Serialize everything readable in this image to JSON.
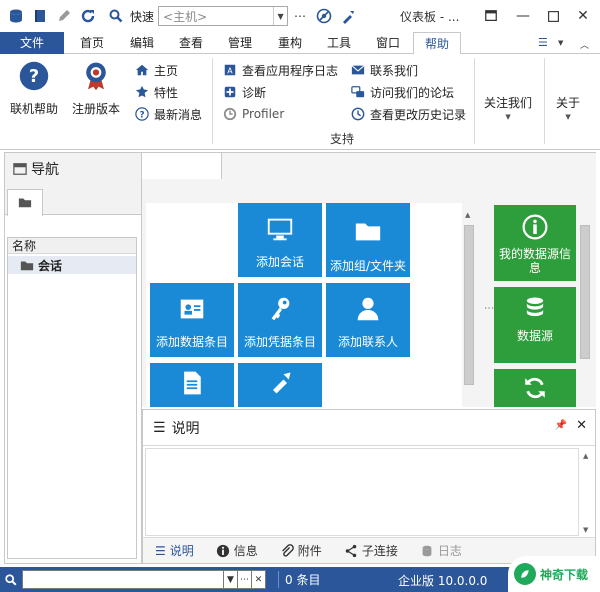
{
  "titlebar": {
    "quick_label": "快速",
    "host_placeholder": "<主机>",
    "window_title": "仪表板 - ...",
    "icons": [
      "database-icon",
      "book-icon",
      "pencil-icon",
      "refresh-icon",
      "search-icon",
      "more-icon",
      "disconnect-icon",
      "tool-icon",
      "pin-window-icon",
      "minimize-icon",
      "restore-icon",
      "close-icon"
    ]
  },
  "ribbon_tabs": [
    "文件",
    "首页",
    "编辑",
    "查看",
    "管理",
    "重构",
    "工具",
    "窗口",
    "帮助"
  ],
  "ribbon": {
    "online_help": "联机帮助",
    "register": "注册版本",
    "home": "主页",
    "features": "特性",
    "latest_news": "最新消息",
    "view_app_log": "查看应用程序日志",
    "diagnostics": "诊断",
    "profiler": "Profiler",
    "contact_us": "联系我们",
    "visit_forum": "访问我们的论坛",
    "view_changelog": "查看更改历史记录",
    "support_group": "支持",
    "follow_us": "关注我们",
    "about": "关于"
  },
  "nav": {
    "title": "导航",
    "tree_header": "名称",
    "tree_item": "会话"
  },
  "dashboard": {
    "tiles": [
      "添加会话",
      "添加组/文件夹",
      "添加数据条目",
      "添加凭据条目",
      "添加联系人"
    ],
    "right_tiles": [
      "我的数据源信息",
      "数据源"
    ],
    "colors": {
      "tile_blue": "#1b8ad6",
      "tile_green": "#2e9e3c"
    }
  },
  "description": {
    "title": "说明",
    "tabs": [
      "说明",
      "信息",
      "附件",
      "子连接",
      "日志"
    ]
  },
  "statusbar": {
    "search_value": "",
    "entry_count": "0 条目",
    "edition": "企业版 10.0.0.0"
  },
  "watermark": {
    "text": "神奇下载"
  },
  "colors": {
    "accent": "#2b579a"
  }
}
